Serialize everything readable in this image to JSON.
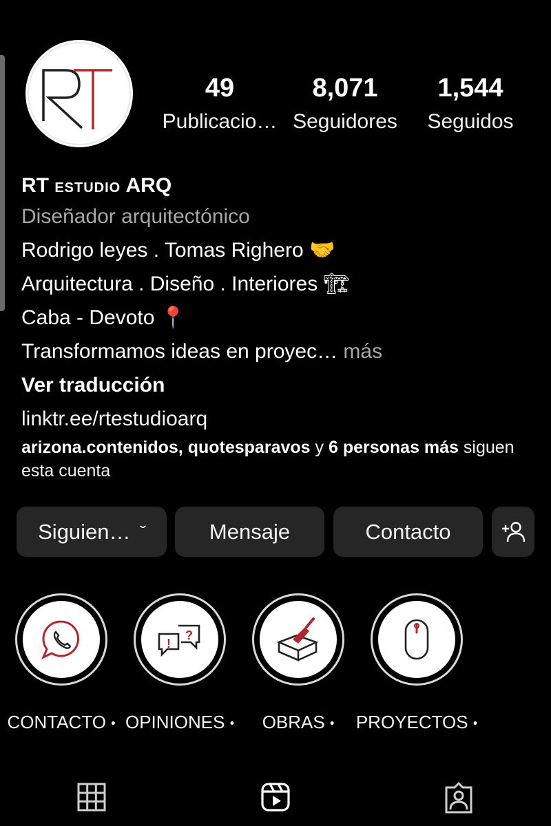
{
  "profile": {
    "name_prefix": "RT",
    "name_middle": "estudio",
    "name_suffix": "ARQ",
    "category": "Diseñador arquitectónico",
    "bio_lines": [
      "Rodrigo leyes . Tomas Righero 🤝",
      "Arquitectura . Diseño . Interiores 🏗",
      "Caba - Devoto 📍",
      "Transformamos ideas en proyec…"
    ],
    "more_label": " más",
    "translate_label": "Ver traducción",
    "link": "linktr.ee/rtestudioarq",
    "followed_by": {
      "user1": "arizona.contenidos",
      "sep": ", ",
      "user2": "quotesparavos",
      "and": " y ",
      "others": "6 personas más",
      "tail": " siguen esta cuenta"
    },
    "avatar_letters": "RT"
  },
  "stats": {
    "posts": {
      "value": "49",
      "label": "Publicacio…"
    },
    "followers": {
      "value": "8,071",
      "label": "Seguidores"
    },
    "following": {
      "value": "1,544",
      "label": "Seguidos"
    }
  },
  "actions": {
    "following_label": "Siguien…",
    "following_chevron": "ˇ",
    "message_label": "Mensaje",
    "contact_label": "Contacto",
    "add_icon": "add-person-icon"
  },
  "highlights": [
    {
      "label": "CONTACTO",
      "icon": "whatsapp-icon"
    },
    {
      "label": "OPINIONES",
      "icon": "speech-bubbles-icon"
    },
    {
      "label": "OBRAS",
      "icon": "brick-trowel-icon"
    },
    {
      "label": "PROYECTOS",
      "icon": "mouse-icon"
    }
  ],
  "highlight_dot": "•",
  "tabs": [
    {
      "icon": "grid-icon"
    },
    {
      "icon": "reels-icon"
    },
    {
      "icon": "tagged-icon"
    }
  ],
  "colors": {
    "background": "#000000",
    "button": "#262626",
    "muted_text": "#a8a8a8",
    "accent_red": "#b3262b"
  }
}
